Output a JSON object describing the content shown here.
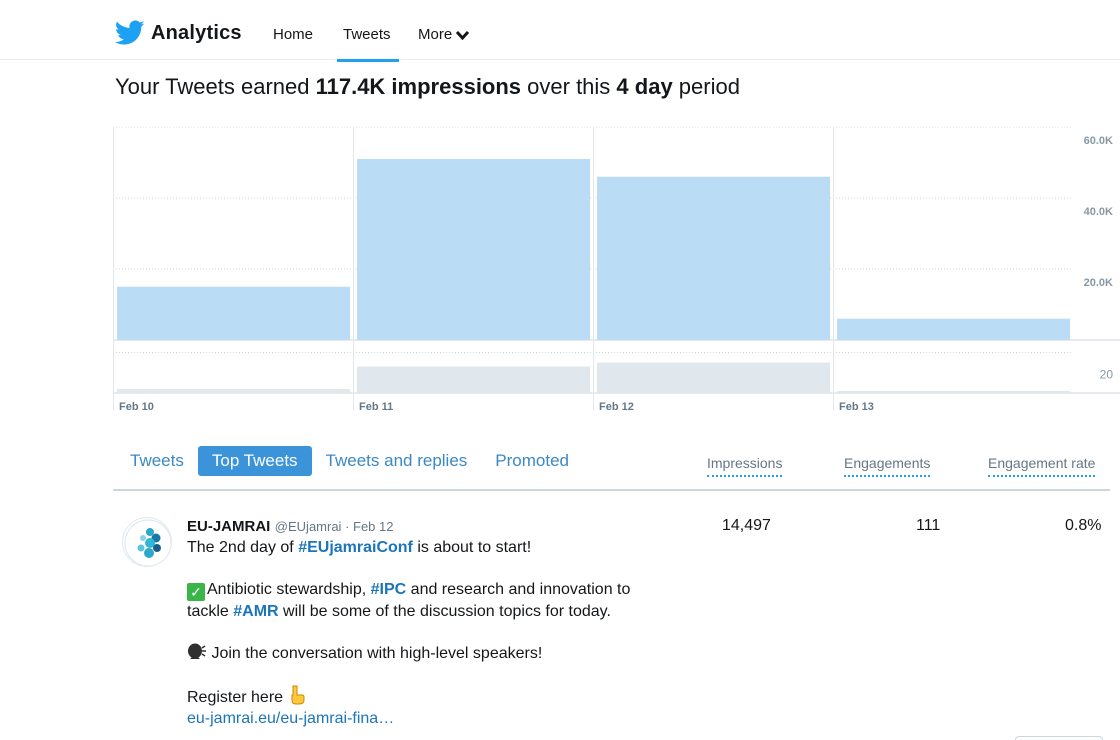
{
  "nav": {
    "brand": "Analytics",
    "home": "Home",
    "tweets": "Tweets",
    "more": "More"
  },
  "headline": {
    "prefix": "Your Tweets earned ",
    "impressions": "117.4K impressions",
    "middle": " over this ",
    "period": "4 day",
    "suffix": " period"
  },
  "chart_data": {
    "type": "bar",
    "categories": [
      "Feb 10",
      "Feb 11",
      "Feb 12",
      "Feb 13"
    ],
    "series": [
      {
        "values": [
          15000,
          51000,
          46000,
          6000
        ],
        "color": "#bbdcf5"
      },
      {
        "values": [
          3,
          20,
          23,
          1
        ],
        "color": "#e1e8ed"
      }
    ],
    "y_ticks_top": [
      "60.0K",
      "40.0K",
      "20.0K"
    ],
    "ylim_top": [
      0,
      60000
    ],
    "y_ticks_bottom": [
      "20"
    ],
    "ylim_bottom": [
      0,
      40
    ],
    "grid": true
  },
  "tabs": [
    "Tweets",
    "Top Tweets",
    "Tweets and replies",
    "Promoted"
  ],
  "active_tab": "Top Tweets",
  "columns": [
    "Impressions",
    "Engagements",
    "Engagement rate"
  ],
  "tweet": {
    "name": "EU-JAMRAI",
    "handle": "@EUjamrai",
    "sep": " · ",
    "date": "Feb 12",
    "l1_prefix": "The 2nd day of ",
    "l1_hash": "#EUjamraiConf",
    "l1_suffix": " is about to start!",
    "p2_a": "Antibiotic stewardship, ",
    "p2_hash1": "#IPC",
    "p2_b": " and research and innovation to tackle ",
    "p2_hash2": "#AMR",
    "p2_c": " will be some of the discussion topics for today.",
    "p3": " Join the conversation with high-level speakers!",
    "p4": "Register here ",
    "link": "eu-jamrai.eu/eu-jamrai-fina…",
    "impressions": "14,497",
    "engagements": "111",
    "rate": "0.8%"
  },
  "colors": {
    "accent": "#1da1f2",
    "tab_active": "#3b94d9",
    "link": "#1b75bb",
    "bar_top": "#bbdcf5",
    "bar_bottom": "#e1e8ed"
  }
}
